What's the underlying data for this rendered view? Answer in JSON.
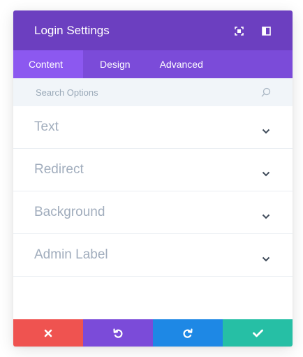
{
  "header": {
    "title": "Login Settings",
    "icons": [
      "expand-icon",
      "sidebar-icon"
    ],
    "background": "#6c3fc0"
  },
  "tabs": [
    {
      "label": "Content",
      "active": true
    },
    {
      "label": "Design",
      "active": false
    },
    {
      "label": "Advanced",
      "active": false
    }
  ],
  "search": {
    "placeholder": "Search Options",
    "icon": "search-icon"
  },
  "sections": [
    {
      "label": "Text"
    },
    {
      "label": "Redirect"
    },
    {
      "label": "Background"
    },
    {
      "label": "Admin Label"
    }
  ],
  "footer": {
    "buttons": [
      {
        "action": "cancel",
        "icon": "close-icon",
        "color": "#ef5350"
      },
      {
        "action": "undo",
        "icon": "undo-icon",
        "color": "#7b4bd9"
      },
      {
        "action": "redo",
        "icon": "redo-icon",
        "color": "#1e88e5"
      },
      {
        "action": "save",
        "icon": "check-icon",
        "color": "#26bfa5"
      }
    ]
  }
}
